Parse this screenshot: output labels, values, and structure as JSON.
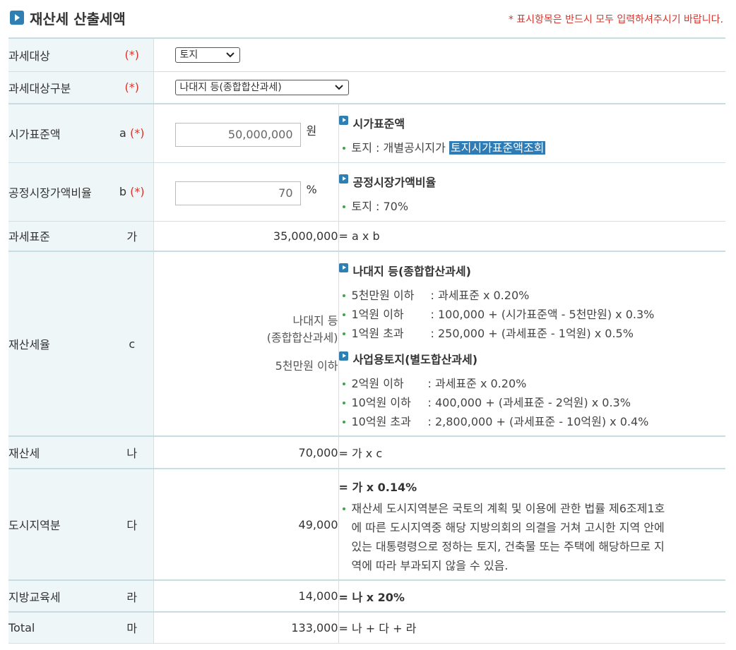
{
  "header": {
    "title": "재산세 산출세액",
    "required_note": "* 표시항목은 반드시 모두 입력하셔주시기 바랍니다."
  },
  "rows": {
    "tax_object": {
      "label": "과세대상",
      "marker": "(*)",
      "select_value": "토지"
    },
    "tax_object_type": {
      "label": "과세대상구분",
      "marker": "(*)",
      "select_value": "나대지 등(종합합산과세)"
    },
    "standard_price": {
      "label": "시가표준액",
      "symbol": "a",
      "marker": "(*)",
      "value": "50,000,000",
      "unit": "원",
      "info_title": "시가표준액",
      "info_text": "토지 : 개별공시지가",
      "info_link": "토지시가표준액조회"
    },
    "market_ratio": {
      "label": "공정시장가액비율",
      "symbol": "b",
      "marker": "(*)",
      "value": "70",
      "unit": "%",
      "info_title": "공정시장가액비율",
      "info_text": "토지 : 70%"
    },
    "tax_base": {
      "label": "과세표준",
      "symbol": "가",
      "value": "35,000,000",
      "formula": "= a x b"
    },
    "tax_rate": {
      "label": "재산세율",
      "symbol": "c",
      "value_line1": "나대지 등",
      "value_line2": "(종합합산과세)",
      "value_line3": "5천만원 이하",
      "group1_title": "나대지 등(종합합산과세)",
      "group1": [
        {
          "cond": "5천만원 이하",
          "rule": ": 과세표준 x 0.20%"
        },
        {
          "cond": "1억원 이하",
          "rule": ": 100,000 + (시가표준액 - 5천만원) x 0.3%"
        },
        {
          "cond": "1억원 초과",
          "rule": ": 250,000 + (과세표준 - 1억원) x 0.5%"
        }
      ],
      "group2_title": "사업용토지(별도합산과세)",
      "group2": [
        {
          "cond": "2억원 이하",
          "rule": ": 과세표준 x 0.20%"
        },
        {
          "cond": "10억원 이하",
          "rule": ": 400,000 + (과세표준 - 2억원) x 0.3%"
        },
        {
          "cond": "10억원 초과",
          "rule": ": 2,800,000 + (과세표준 - 10억원) x 0.4%"
        }
      ]
    },
    "property_tax": {
      "label": "재산세",
      "symbol": "나",
      "value": "70,000",
      "formula": "= 가 x c"
    },
    "urban_area": {
      "label": "도시지역분",
      "symbol": "다",
      "value": "49,000",
      "formula": "= 가 x 0.14%",
      "note_l1": "재산세 도시지역분은 국토의 계획 및 이용에 관한 법률 제6조제1호",
      "note_l2": "에 따른 도시지역중 해당 지방의회의 의결을 거쳐 고시한 지역 안에",
      "note_l3": "있는 대통령령으로 정하는 토지, 건축물 또는 주택에 해당하므로 지",
      "note_l4": "역에 따라 부과되지 않을 수 있음."
    },
    "education_tax": {
      "label": "지방교육세",
      "symbol": "라",
      "value": "14,000",
      "formula": "= 나 x 20%"
    },
    "total": {
      "label": "Total",
      "symbol": "마",
      "value": "133,000",
      "formula": "= 나 + 다 + 라"
    }
  }
}
